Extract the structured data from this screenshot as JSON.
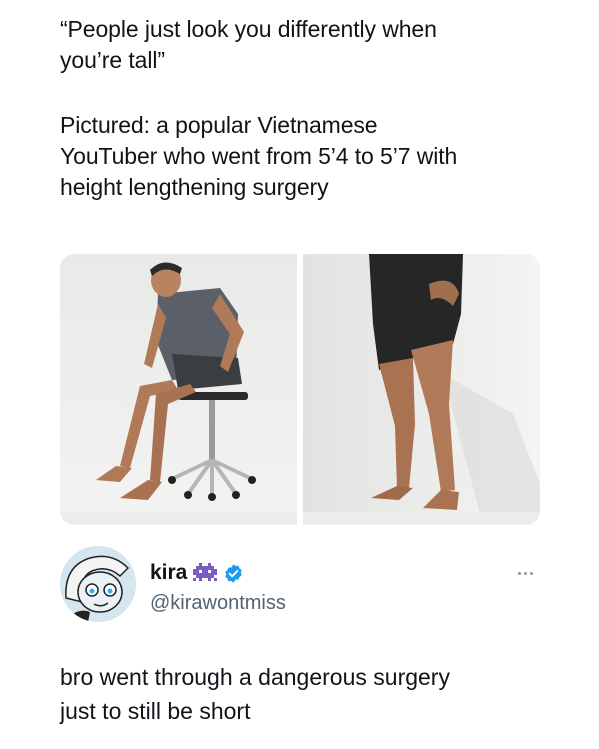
{
  "quoted_post": {
    "line1": "“People just look you differently when",
    "line2": "you’re tall”",
    "line3": "Pictured: a popular Vietnamese",
    "line4": "YouTuber who went from 5’4 to 5’7 with",
    "line5": "height lengthening surgery"
  },
  "media": {
    "left_photo": "seated man photo",
    "right_photo": "legs after surgery photo"
  },
  "author": {
    "display_name": "kira",
    "name_emoji": "alien-monster-icon",
    "verified": "verified-badge-icon",
    "handle": "@kirawontmiss",
    "more": "more-options-icon"
  },
  "reply": {
    "line1": "bro went through a dangerous surgery",
    "line2": "just to still be short"
  },
  "colors": {
    "text": "#0f1419",
    "secondary": "#536471",
    "verified": "#1d9bf0",
    "emoji": "#7b5cc4"
  }
}
